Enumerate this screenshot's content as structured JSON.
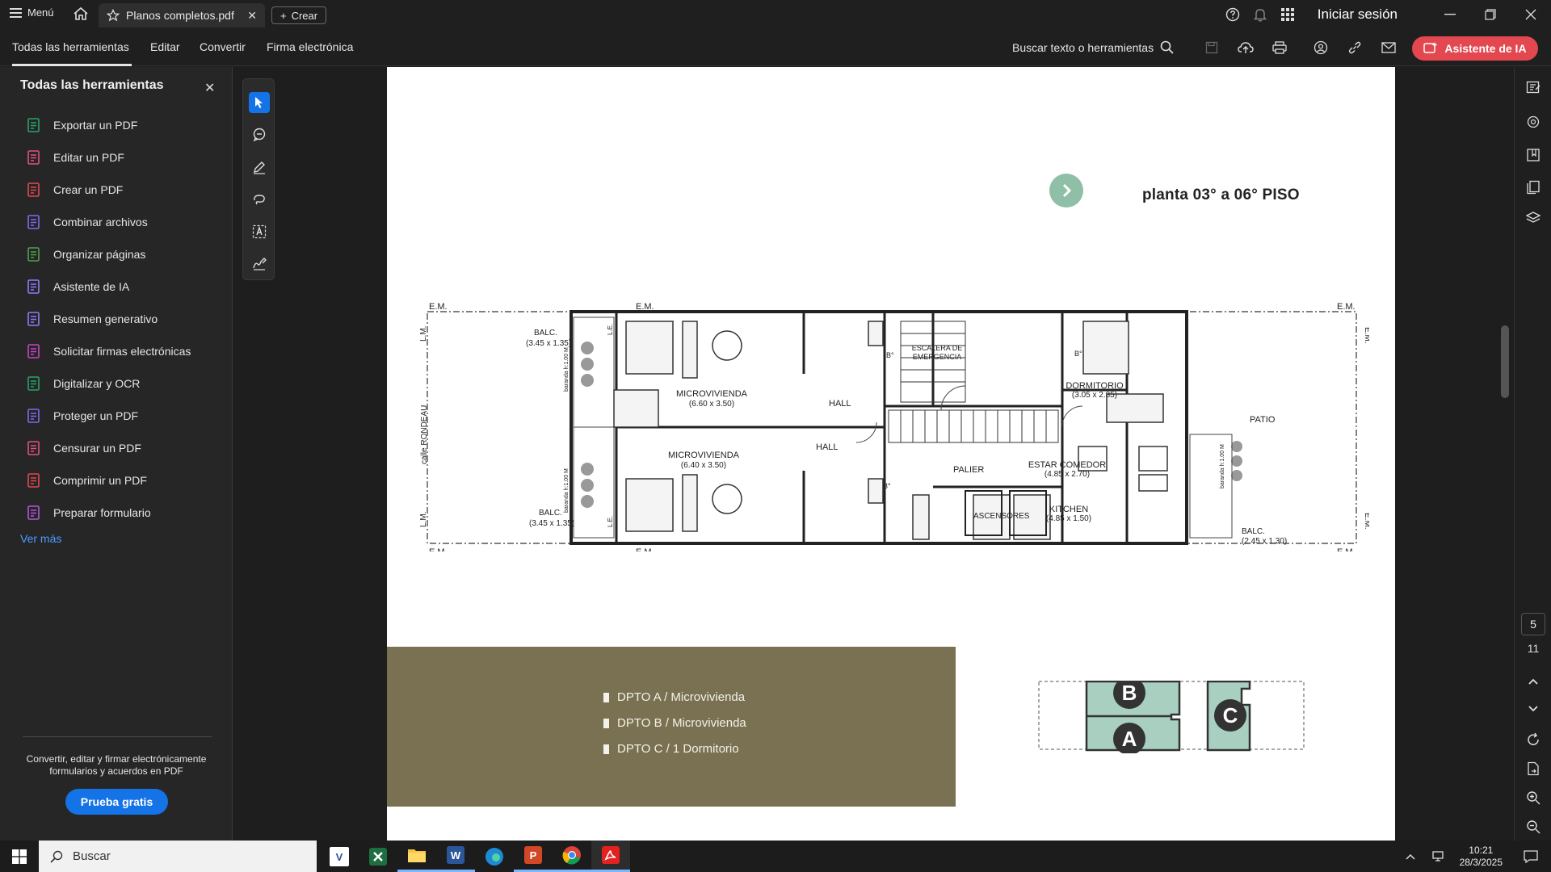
{
  "titlebar": {
    "menu_label": "Menú",
    "doc_tab_title": "Planos completos.pdf",
    "create_label": "Crear",
    "signin_label": "Iniciar sesión"
  },
  "menubar": {
    "tabs": [
      "Todas las herramientas",
      "Editar",
      "Convertir",
      "Firma electrónica"
    ],
    "search_label": "Buscar texto o herramientas",
    "ai_button_label": "Asistente de IA"
  },
  "leftpanel": {
    "title": "Todas las herramientas",
    "tools": [
      {
        "label": "Exportar un PDF",
        "icon": "export-pdf-icon",
        "color": "#29a36a"
      },
      {
        "label": "Editar un PDF",
        "icon": "edit-pdf-icon",
        "color": "#e34f88"
      },
      {
        "label": "Crear un PDF",
        "icon": "create-pdf-icon",
        "color": "#e34850"
      },
      {
        "label": "Combinar archivos",
        "icon": "combine-files-icon",
        "color": "#7b6cf0"
      },
      {
        "label": "Organizar páginas",
        "icon": "organize-pages-icon",
        "color": "#4fa34b"
      },
      {
        "label": "Asistente de IA",
        "icon": "ai-assistant-icon",
        "color": "#8f7cff"
      },
      {
        "label": "Resumen generativo",
        "icon": "generative-summary-icon",
        "color": "#8f7cff"
      },
      {
        "label": "Solicitar firmas electrónicas",
        "icon": "request-signatures-icon",
        "color": "#c744c4"
      },
      {
        "label": "Digitalizar y OCR",
        "icon": "scan-ocr-icon",
        "color": "#29a36a"
      },
      {
        "label": "Proteger un PDF",
        "icon": "protect-pdf-icon",
        "color": "#7b6cf0"
      },
      {
        "label": "Censurar un PDF",
        "icon": "redact-pdf-icon",
        "color": "#e34f88"
      },
      {
        "label": "Comprimir un PDF",
        "icon": "compress-pdf-icon",
        "color": "#e34850"
      },
      {
        "label": "Preparar formulario",
        "icon": "prepare-form-icon",
        "color": "#b456e0"
      }
    ],
    "see_more": "Ver más",
    "promo_text": "Convertir, editar y firmar electrónicamente formularios y acuerdos en PDF",
    "trial_button": "Prueba gratis"
  },
  "document": {
    "page_title": "planta 03° a 06°  PISO",
    "plan_labels": {
      "em": "E.M.",
      "lm": "L.M.",
      "balc_top": "BALC.",
      "balc_top_dim": "(3.45 x 1.35)",
      "balc_bottom": "BALC.",
      "balc_bottom_dim": "(3.45 x 1.35)",
      "micro_a": "MICROVIVIENDA",
      "micro_a_dim": "(6.60 x 3.50)",
      "micro_b": "MICROVIVIENDA",
      "micro_b_dim": "(6.40 x 3.50)",
      "hall": "HALL",
      "escalera": "ESCALERA DE",
      "emergencia": "EMERGENCIA",
      "palier": "PALIER",
      "ascensores": "ASCENSORES",
      "dormitorio": "DORMITORIO",
      "dormitorio_dim": "(3.05 x 2.85)",
      "estar": "ESTAR COMEDOR",
      "estar_dim": "(4.85 x 2.70)",
      "kitchen": "KITCHEN",
      "kitchen_dim": "(4.85 x 1.50)",
      "patio": "PATIO",
      "balc_right": "BALC.",
      "balc_right_dim": "(2.45 x 1.30)",
      "calle": "calle RONDEAU",
      "banio": "B°",
      "baranda": "baranda h:1.00 M",
      "le": "L.E."
    },
    "legend": [
      "DPTO A / Microvivienda",
      "DPTO B / Microvivienda",
      "DPTO C / 1 Dormitorio"
    ],
    "keyplan": {
      "a": "A",
      "b": "B",
      "c": "C"
    }
  },
  "rightrail": {
    "current_page": "5",
    "total_pages": "11"
  },
  "taskbar": {
    "search_label": "Buscar",
    "time": "10:21",
    "date": "28/3/2025"
  },
  "colors": {
    "accent_blue": "#1473e6",
    "ai_red": "#e34850",
    "legend_olive": "#7a7152",
    "keyplan_green": "#a9cfc0"
  }
}
